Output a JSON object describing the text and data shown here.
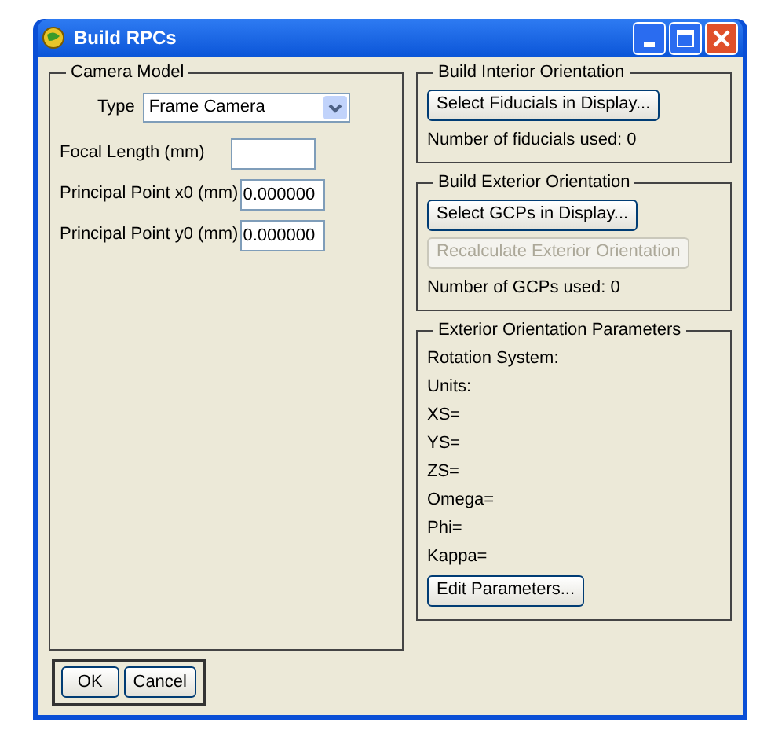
{
  "window": {
    "title": "Build RPCs"
  },
  "camera_model": {
    "title": "Camera Model",
    "fields": [
      {
        "kind": "select",
        "label": "Type",
        "value": "Frame Camera"
      },
      {
        "kind": "text",
        "label": "Focal Length (mm)"
      },
      {
        "kind": "text",
        "label": "Principal Point x0 (mm)",
        "value": "0.000000"
      },
      {
        "kind": "text",
        "label": "Principal Point y0 (mm)",
        "value": "0.000000"
      }
    ]
  },
  "interior_orientation": {
    "title": "Build Interior Orientation",
    "buttons": [
      {
        "label": "Select Fiducials in Display...",
        "disabled": false
      }
    ],
    "status": "Number of fiducials used: 0"
  },
  "exterior_orientation": {
    "title": "Build Exterior Orientation",
    "buttons": [
      {
        "label": "Select GCPs in Display...",
        "disabled": false
      },
      {
        "label": "Recalculate Exterior Orientation",
        "disabled": true
      }
    ],
    "status": "Number of GCPs used: 0"
  },
  "exterior_parameters": {
    "title": "Exterior Orientation Parameters",
    "lines": [
      "Rotation System:",
      "Units:",
      "XS=",
      "YS=",
      "ZS=",
      "Omega=",
      "Phi=",
      "Kappa="
    ],
    "button": {
      "label": "Edit Parameters..."
    }
  },
  "footer_buttons": [
    "OK",
    "Cancel"
  ]
}
